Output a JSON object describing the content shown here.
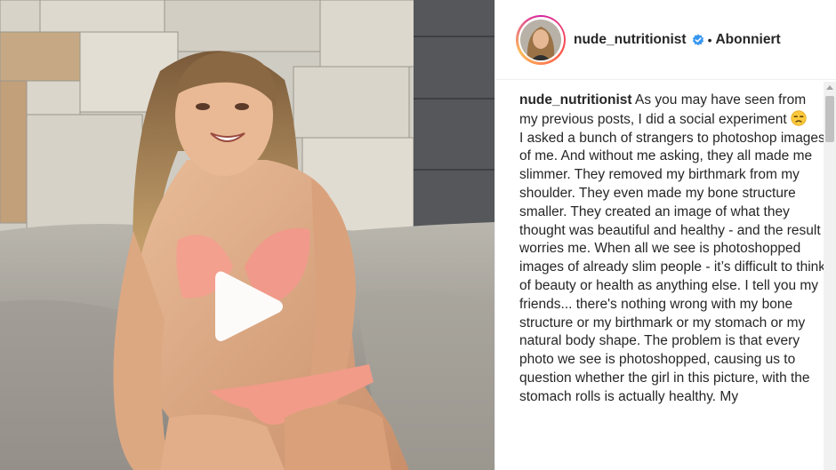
{
  "media": {
    "type": "video",
    "play_icon": "play-icon"
  },
  "post": {
    "username": "nude_nutritionist",
    "verified_icon": "verified-badge-icon",
    "verified_color": "#3897f0",
    "separator": "•",
    "follow_status": "Abonniert",
    "caption": {
      "username": "nude_nutritionist",
      "intro": "As you may have seen from my previous posts, I did a social experiment",
      "emoji": "unamused-face-icon",
      "body": "I asked a bunch of strangers to photoshop images of me. And without me asking, they all made me slimmer. They removed my birthmark from my shoulder. They even made my bone structure smaller. They created an image of what they thought was beautiful and healthy - and the result worries me. When all we see is photoshopped images of already slim people - it’s difficult to think of beauty or health as anything else. I tell you my friends... there's nothing wrong with my bone structure or my birthmark or my stomach or my natural body shape. The problem is that every photo we see is photoshopped, causing us to question whether the girl in this picture, with the stomach rolls is actually healthy. My"
    }
  },
  "colors": {
    "text": "#262626",
    "border": "#efefef",
    "bikini": "#f3a08e"
  }
}
